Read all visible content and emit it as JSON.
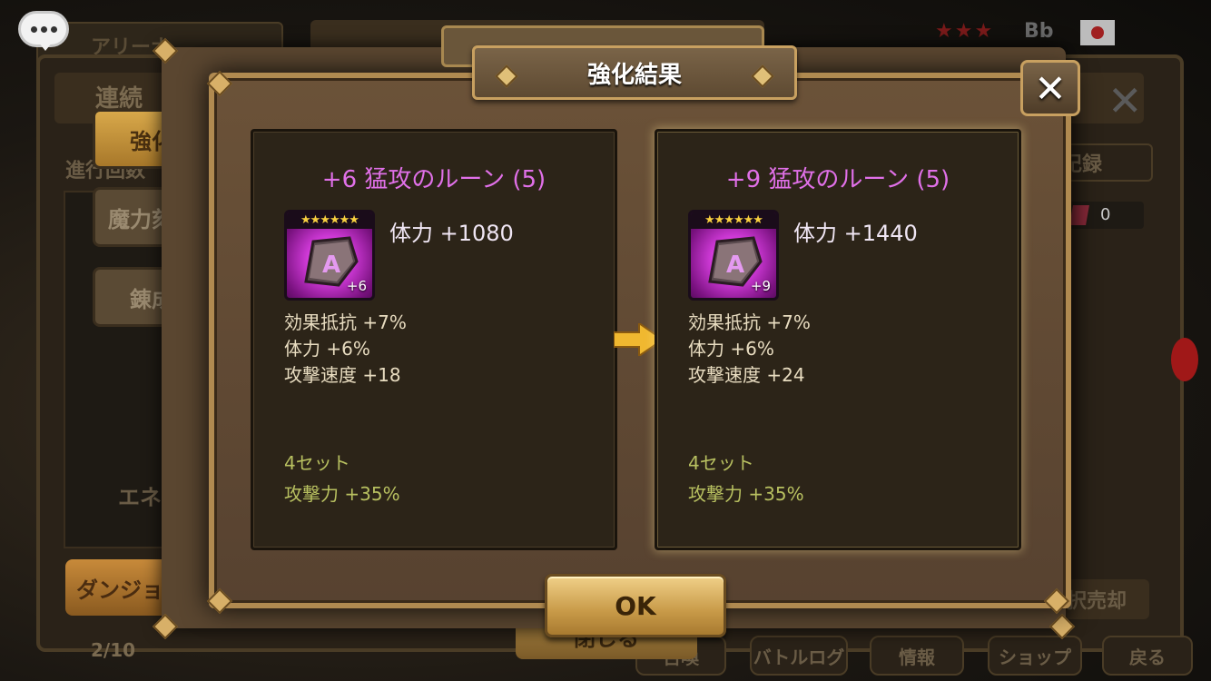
{
  "background": {
    "top_tab_label": "アリーナ",
    "panel_title": "連続",
    "progress_label": "進行回数",
    "tabs": [
      "強化",
      "魔力刻印",
      "錬成"
    ],
    "energy_label": "エネ",
    "dungeon_button": "ダンジョ",
    "count": "2/10",
    "record_button": "記録",
    "gem_count": "0",
    "sell_button": "択売却",
    "close_button": "閉じる",
    "player_name": "Bb",
    "bottom_buttons": [
      "召喚",
      "バトルログ",
      "情報",
      "ショップ",
      "戻る"
    ]
  },
  "dialog": {
    "title": "強化結果",
    "close_label": "✕",
    "ok_label": "OK"
  },
  "before": {
    "name": "+6 猛攻のルーン (5)",
    "stars": "★★★★★★",
    "level_badge": "+6",
    "main_stat": "体力 +1080",
    "sub_stats": [
      {
        "name": "効果抵抗",
        "value": "+7%"
      },
      {
        "name": "体力",
        "value": "+6%"
      },
      {
        "name": "攻撃速度",
        "value": "+18"
      }
    ],
    "set_label": "4セット",
    "set_bonus": "攻撃力 +35%"
  },
  "after": {
    "name": "+9 猛攻のルーン (5)",
    "stars": "★★★★★★",
    "level_badge": "+9",
    "main_stat": "体力 +1440",
    "sub_stats": [
      {
        "name": "効果抵抗",
        "value": "+7%"
      },
      {
        "name": "体力",
        "value": "+6%"
      },
      {
        "name": "攻撃速度",
        "value": "+24"
      }
    ],
    "set_label": "4セット",
    "set_bonus": "攻撃力 +35%"
  },
  "icons": {
    "chat": "chat-bubble-icon",
    "arrow": "arrow-right-icon",
    "rune": "rune-violent-icon"
  },
  "colors": {
    "rune_name": "#e070e8",
    "set_text": "#b8c060",
    "frame_gold": "#b08a50"
  }
}
